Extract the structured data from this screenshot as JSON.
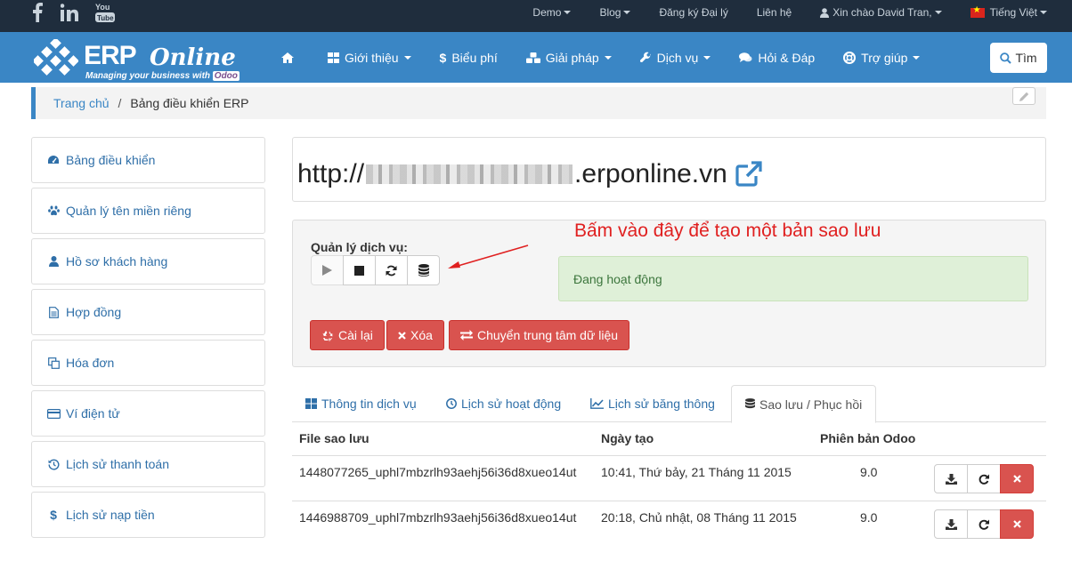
{
  "topbar": {
    "nav": [
      {
        "label": "Demo",
        "caret": true
      },
      {
        "label": "Blog",
        "caret": true
      },
      {
        "label": "Đăng ký Đại lý",
        "caret": false
      },
      {
        "label": "Liên hệ",
        "caret": false
      },
      {
        "label": "Xin chào David Tran,",
        "caret": true
      },
      {
        "label": "Tiếng Việt",
        "caret": true
      }
    ]
  },
  "logo": {
    "erp": "ERP",
    "online": "Online",
    "tagline": "Managing your business with",
    "odoo": "Odoo"
  },
  "mainnav": {
    "items": [
      {
        "label": "",
        "icon": "home-icon"
      },
      {
        "label": "Giới thiệu",
        "icon": "grid-icon",
        "caret": true
      },
      {
        "label": "Biểu phí",
        "icon": "dollar-icon"
      },
      {
        "label": "Giải pháp",
        "icon": "cubes-icon",
        "caret": true
      },
      {
        "label": "Dịch vụ",
        "icon": "wrench-icon",
        "caret": true
      },
      {
        "label": "Hỏi & Đáp",
        "icon": "comments-icon"
      },
      {
        "label": "Trợ giúp",
        "icon": "lifebuoy-icon",
        "caret": true
      }
    ],
    "search_label": "Tìm"
  },
  "breadcrumb": {
    "home": "Trang chủ",
    "separator": "/",
    "current": "Bảng điều khiển ERP"
  },
  "sidebar": {
    "items": [
      {
        "label": "Bảng điều khiển",
        "icon": "dashboard-icon"
      },
      {
        "label": "Quản lý tên miền riêng",
        "icon": "paw-icon"
      },
      {
        "label": "Hồ sơ khách hàng",
        "icon": "user-icon"
      },
      {
        "label": "Hợp đồng",
        "icon": "file-text-icon"
      },
      {
        "label": "Hóa đơn",
        "icon": "copy-icon"
      },
      {
        "label": "Ví điện tử",
        "icon": "credit-card-icon"
      },
      {
        "label": "Lịch sử thanh toán",
        "icon": "history-icon"
      },
      {
        "label": "Lịch sử nạp tiền",
        "icon": "dollar-icon"
      }
    ]
  },
  "url": {
    "prefix": "http://",
    "suffix": ".erponline.vn"
  },
  "service": {
    "label": "Quản lý dịch vụ:",
    "annotation": "Bấm vào đây để tạo một bản sao lưu",
    "status": "Đang hoạt động",
    "actions": [
      {
        "label": "Cài lại",
        "icon": "recycle-icon"
      },
      {
        "label": "Xóa",
        "icon": "times-icon"
      },
      {
        "label": "Chuyển trung tâm dữ liệu",
        "icon": "exchange-icon"
      }
    ]
  },
  "tabs": [
    {
      "label": "Thông tin dịch vụ",
      "icon": "th-large-icon"
    },
    {
      "label": "Lịch sử hoạt động",
      "icon": "clock-icon"
    },
    {
      "label": "Lịch sử băng thông",
      "icon": "line-chart-icon"
    },
    {
      "label": "Sao lưu / Phục hồi",
      "icon": "database-icon",
      "active": true
    }
  ],
  "backups": {
    "headers": [
      "File sao lưu",
      "Ngày tạo",
      "Phiên bản Odoo"
    ],
    "rows": [
      {
        "file": "1448077265_uphl7mbzrlh93aehj56i36d8xueo14ut",
        "date": "10:41, Thứ bảy, 21 Tháng 11 2015",
        "version": "9.0"
      },
      {
        "file": "1446988709_uphl7mbzrlh93aehj56i36d8xueo14ut",
        "date": "20:18, Chủ nhật, 08 Tháng 11 2015",
        "version": "9.0"
      }
    ]
  },
  "colors": {
    "topbar": "#1f2d3d",
    "nav": "#3a86c5",
    "link": "#2f6fa8",
    "danger": "#d9534f",
    "success_bg": "#dff0d8",
    "annotation": "#e02020"
  }
}
